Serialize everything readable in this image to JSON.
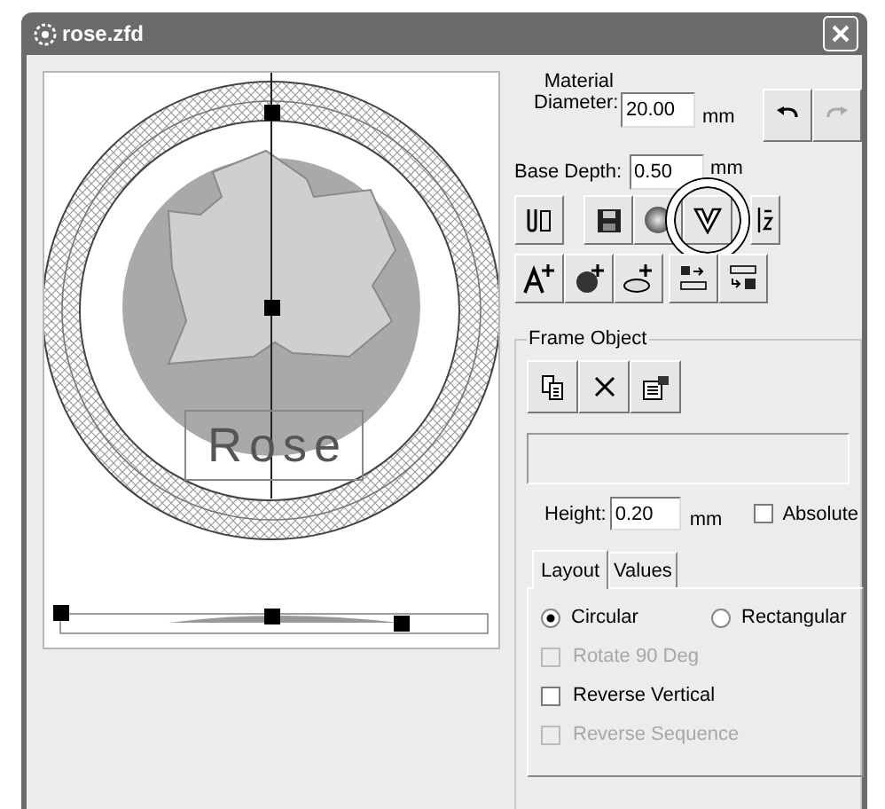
{
  "window": {
    "title": "rose.zfd"
  },
  "canvas": {
    "label": "Rose"
  },
  "material_diameter": {
    "label": "Material Diameter:",
    "value": "20.00",
    "unit": "mm"
  },
  "history_buttons": [
    {
      "kind": "undo",
      "disabled": false
    },
    {
      "kind": "redo",
      "disabled": true
    }
  ],
  "base_depth": {
    "label": "Base Depth:",
    "value": "0.50",
    "unit": "mm"
  },
  "tool_rows": [
    [
      {
        "kind": "import",
        "highlighted": false
      },
      {
        "kind": "save",
        "highlighted": false
      },
      {
        "kind": "sphere",
        "highlighted": false
      },
      {
        "kind": "vcarve",
        "highlighted": true
      },
      {
        "kind": "slice",
        "highlighted": false
      }
    ],
    [
      {
        "kind": "add-text",
        "highlighted": false
      },
      {
        "kind": "add-blob",
        "highlighted": false
      },
      {
        "kind": "add-dish",
        "highlighted": false
      },
      {
        "kind": "to-text",
        "highlighted": false
      },
      {
        "kind": "from-text",
        "highlighted": false
      }
    ]
  ],
  "frame_object": {
    "title": "Frame Object",
    "height": {
      "label": "Height:",
      "value": "0.20",
      "unit": "mm"
    },
    "absolute": {
      "label": "Absolute",
      "checked": false
    },
    "tabs": [
      {
        "label": "Layout",
        "selected": true
      },
      {
        "label": "Values",
        "selected": false
      }
    ],
    "shape_options": [
      {
        "label": "Circular",
        "selected": true
      },
      {
        "label": "Rectangular",
        "selected": false
      }
    ],
    "options": [
      {
        "label": "Rotate 90 Deg",
        "checked": false,
        "disabled": true
      },
      {
        "label": "Reverse Vertical",
        "checked": false,
        "disabled": false
      },
      {
        "label": "Reverse Sequence",
        "checked": false,
        "disabled": true
      }
    ]
  }
}
